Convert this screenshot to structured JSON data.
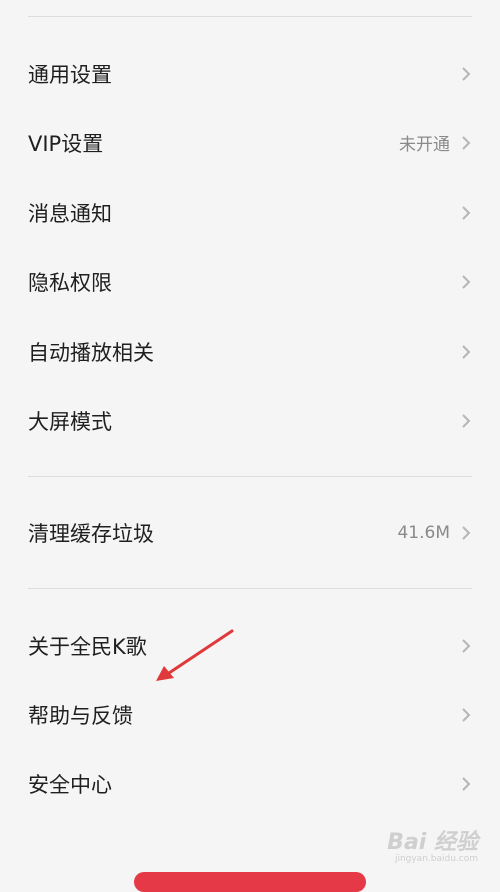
{
  "settings_group_1": [
    {
      "label": "通用设置",
      "value": ""
    },
    {
      "label": "VIP设置",
      "value": "未开通"
    },
    {
      "label": "消息通知",
      "value": ""
    },
    {
      "label": "隐私权限",
      "value": ""
    },
    {
      "label": "自动播放相关",
      "value": ""
    },
    {
      "label": "大屏模式",
      "value": ""
    }
  ],
  "settings_group_2": [
    {
      "label": "清理缓存垃圾",
      "value": "41.6M"
    }
  ],
  "settings_group_3": [
    {
      "label": "关于全民K歌",
      "value": ""
    },
    {
      "label": "帮助与反馈",
      "value": ""
    },
    {
      "label": "安全中心",
      "value": ""
    }
  ],
  "watermark": {
    "main": "Bai 经验",
    "sub": "jingyan.baidu.com"
  },
  "colors": {
    "annotation_arrow": "#e0393b",
    "logout_button": "#e53947"
  },
  "icons": {
    "row_trailing": "chevron-right-icon",
    "annotation": "red-arrow-annotation"
  }
}
